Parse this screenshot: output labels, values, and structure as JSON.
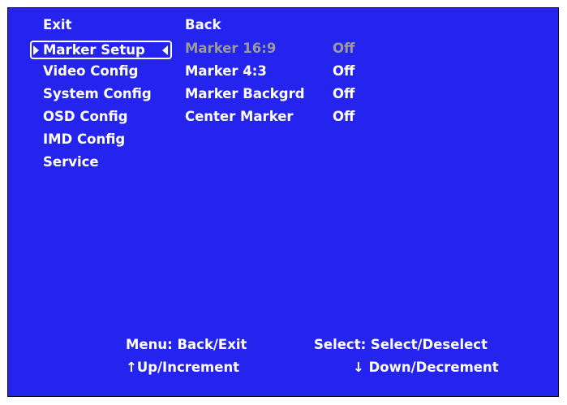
{
  "menu": {
    "items": [
      {
        "label": "Exit"
      },
      {
        "label": "Marker Setup"
      },
      {
        "label": "Video Config"
      },
      {
        "label": "System Config"
      },
      {
        "label": "OSD Config"
      },
      {
        "label": "IMD Config"
      },
      {
        "label": "Service"
      }
    ],
    "selected_index": 1
  },
  "submenu": {
    "back_label": "Back",
    "rows": [
      {
        "label": "Marker 16:9",
        "value": "Off",
        "disabled": true
      },
      {
        "label": "Marker 4:3",
        "value": "Off",
        "disabled": false
      },
      {
        "label": "Marker Backgrd",
        "value": "Off",
        "disabled": false
      },
      {
        "label": "Center Marker",
        "value": "Off",
        "disabled": false
      }
    ]
  },
  "hints": {
    "menu": "Menu: Back/Exit",
    "select": "Select: Select/Deselect",
    "up": "↑Up/Increment",
    "down": "↓ Down/Decrement"
  },
  "colors": {
    "background": "#2424ee",
    "text": "#ffffff",
    "disabled_text": "#9a9a9a"
  },
  "icons": {
    "selection_left": "triangle-right-icon",
    "selection_right": "triangle-left-icon"
  }
}
